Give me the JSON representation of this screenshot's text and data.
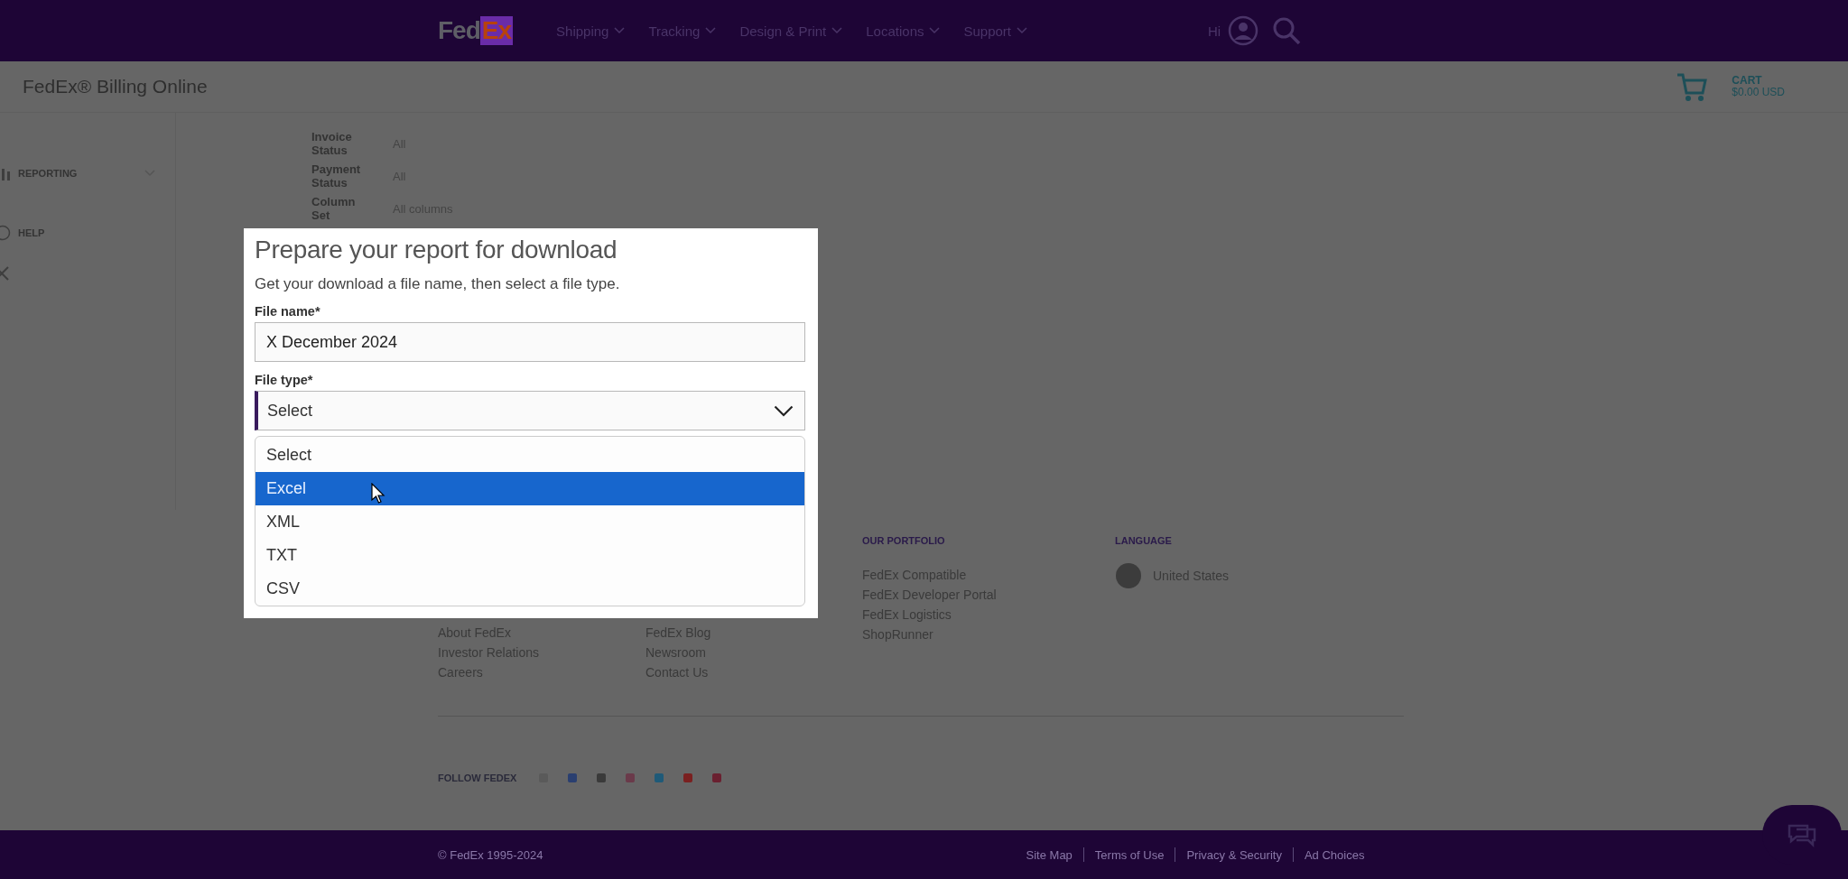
{
  "header": {
    "logo": {
      "part_1": "Fed",
      "part_2": "Ex"
    },
    "nav": [
      {
        "label": "Shipping"
      },
      {
        "label": "Tracking"
      },
      {
        "label": "Design & Print"
      },
      {
        "label": "Locations"
      },
      {
        "label": "Support"
      }
    ],
    "account_label": "Hi"
  },
  "subheader": {
    "title": "FedEx® Billing Online",
    "cart": {
      "label": "CART",
      "amount": "$0.00 USD"
    }
  },
  "sidebar": {
    "items": [
      {
        "label": "REPORTING",
        "expandable": true
      },
      {
        "label": "HELP",
        "expandable": false
      }
    ]
  },
  "filters": [
    {
      "label": "Invoice Status",
      "value": "All"
    },
    {
      "label": "Payment Status",
      "value": "All"
    },
    {
      "label": "Column Set",
      "value": "All columns"
    }
  ],
  "modal": {
    "title": "Prepare your report for download",
    "subtitle": "Get your download a file name, then select a file type.",
    "file_name": {
      "label": "File name*",
      "value": "X December 2024"
    },
    "file_type": {
      "label": "File type*",
      "value": "Select",
      "expanded": true,
      "options": [
        {
          "label": "Select",
          "highlighted": false
        },
        {
          "label": "Excel",
          "highlighted": true
        },
        {
          "label": "XML",
          "highlighted": false
        },
        {
          "label": "TXT",
          "highlighted": false
        },
        {
          "label": "CSV",
          "highlighted": false
        }
      ]
    }
  },
  "footer": {
    "columns": [
      {
        "links": [
          "About FedEx",
          "Investor Relations",
          "Careers"
        ]
      },
      {
        "links": [
          "FedEx Blog",
          "Newsroom",
          "Contact Us"
        ]
      },
      {
        "heading": "OUR PORTFOLIO",
        "links": [
          "FedEx Compatible",
          "FedEx Developer Portal",
          "FedEx Logistics",
          "ShopRunner"
        ]
      }
    ],
    "language": {
      "heading": "LANGUAGE",
      "value": "United States"
    },
    "follow_label": "FOLLOW FEDEX",
    "social": [
      {
        "color": "#5a5a5a"
      },
      {
        "color": "#2a3f70"
      },
      {
        "color": "#3a3a3a"
      },
      {
        "color": "#6a3a4a"
      },
      {
        "color": "#1f5a78"
      },
      {
        "color": "#7a2020"
      },
      {
        "color": "#6a2030"
      }
    ]
  },
  "bottom_bar": {
    "copyright": "© FedEx 1995-2024",
    "links": [
      "Site Map",
      "Terms of Use",
      "Privacy & Security",
      "Ad Choices"
    ]
  }
}
